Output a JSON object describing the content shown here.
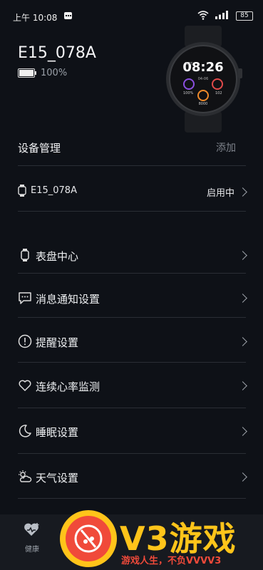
{
  "status_bar": {
    "time": "上午 10:08",
    "battery": "85"
  },
  "device": {
    "name": "E15_078A",
    "battery_pct": "100%"
  },
  "watch_face": {
    "time": "08:26",
    "steps": "8000",
    "pct": "100%",
    "heart": "102"
  },
  "device_management": {
    "title": "设备管理",
    "add_label": "添加"
  },
  "device_row": {
    "name": "E15_078A",
    "status": "启用中"
  },
  "menu": [
    {
      "label": "表盘中心",
      "icon": "watch-face-icon"
    },
    {
      "label": "消息通知设置",
      "icon": "message-icon"
    },
    {
      "label": "提醒设置",
      "icon": "alert-icon"
    },
    {
      "label": "连续心率监测",
      "icon": "heart-icon"
    },
    {
      "label": "睡眠设置",
      "icon": "moon-icon"
    },
    {
      "label": "天气设置",
      "icon": "weather-icon"
    }
  ],
  "bottom_nav": {
    "health_label": "健康"
  },
  "watermark": {
    "logo_text": "V3游戏",
    "slogan": "游戏人生，不负VVVV3"
  },
  "colors": {
    "background": "#0e1117",
    "watermark_yellow": "#ffc41a",
    "watermark_red": "#f04a3a"
  }
}
